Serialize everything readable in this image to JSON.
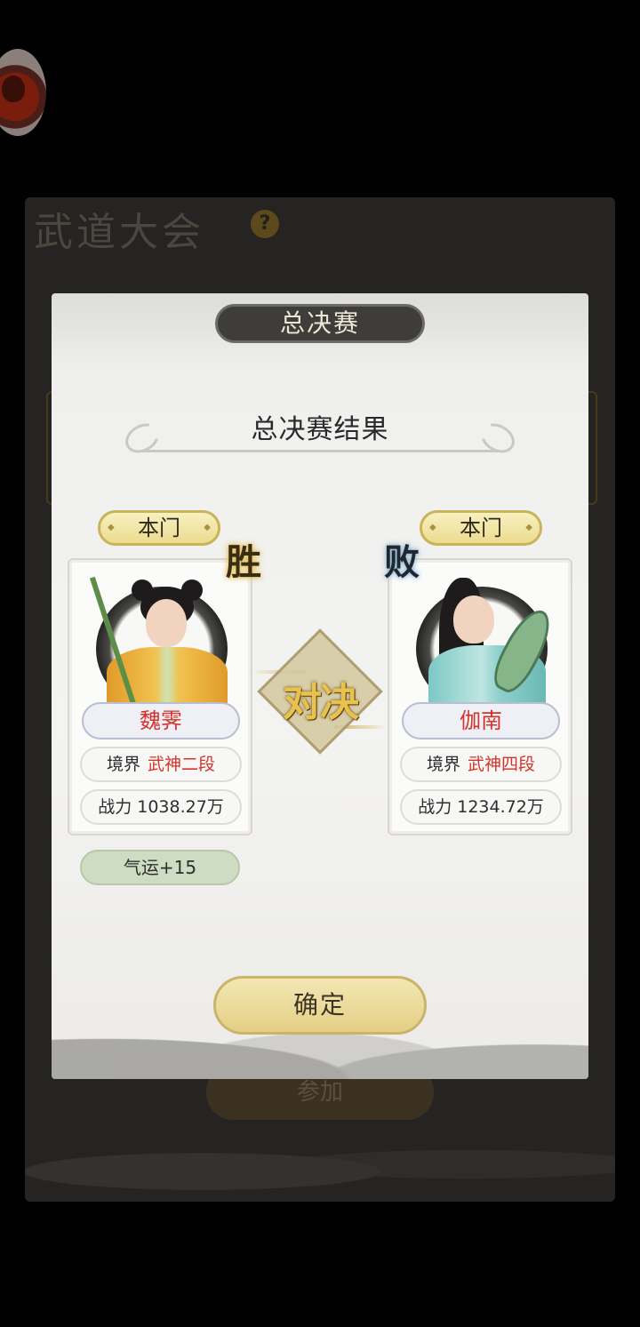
{
  "background_window": {
    "title": "武道大会",
    "help_icon": "?",
    "join_button": "参加"
  },
  "dialog": {
    "tab_title": "总决赛",
    "heading": "总决赛结果",
    "vs_label": "对决",
    "confirm_button": "确定",
    "reward": "气运+15"
  },
  "left_fighter": {
    "sect_tag": "本门",
    "result_mark": "胜",
    "name": "魏霁",
    "realm_label": "境界",
    "realm_value": "武神二段",
    "power_text": "战力 1038.27万"
  },
  "right_fighter": {
    "sect_tag": "本门",
    "result_mark": "败",
    "name": "伽南",
    "realm_label": "境界",
    "realm_value": "武神四段",
    "power_text": "战力 1234.72万"
  }
}
